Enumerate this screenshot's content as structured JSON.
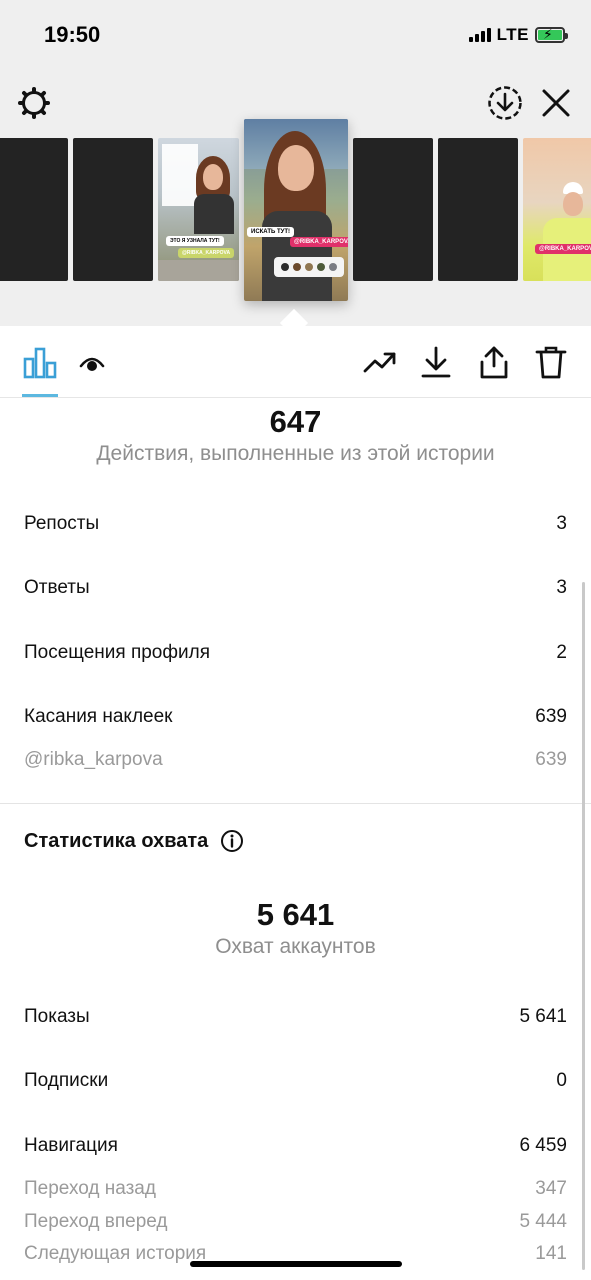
{
  "status_bar": {
    "time": "19:50",
    "network": "LTE",
    "battery_color": "#34c759"
  },
  "top_bar": {
    "left_icon": "settings-gear-icon",
    "right_icons": [
      "download-circle-icon",
      "close-icon"
    ]
  },
  "story_strip": {
    "active_story": {
      "caption": "ИСКАТЬ ТУТ!",
      "tag": "@RIBKA_KARPOVA"
    },
    "left_story": {
      "caption": "ЭТО Я УЗНАЛА ТУТ!",
      "tag": "@RIBKA_KARPOVA"
    },
    "right_story": {
      "tag": "@RIBKA_KARPOVA"
    }
  },
  "tabs": {
    "items": [
      "insights-bar-chart-icon",
      "viewers-eye-icon"
    ],
    "actions": [
      "promote-trend-icon",
      "download-icon",
      "share-icon",
      "delete-trash-icon"
    ],
    "accent_color": "#5cb8e0"
  },
  "interactions": {
    "total": "647",
    "caption": "Действия, выполненные из этой истории",
    "rows": [
      {
        "label": "Репосты",
        "value": "3"
      },
      {
        "label": "Ответы",
        "value": "3"
      },
      {
        "label": "Посещения профиля",
        "value": "2"
      },
      {
        "label": "Касания наклеек",
        "value": "639"
      }
    ],
    "sub_rows": [
      {
        "label": "@ribka_karpova",
        "value": "639"
      }
    ]
  },
  "reach": {
    "title": "Статистика охвата",
    "total": "5 641",
    "caption": "Охват аккаунтов",
    "rows": [
      {
        "label": "Показы",
        "value": "5 641"
      },
      {
        "label": "Подписки",
        "value": "0"
      },
      {
        "label": "Навигация",
        "value": "6 459"
      }
    ],
    "sub_rows": [
      {
        "label": "Переход назад",
        "value": "347"
      },
      {
        "label": "Переход вперед",
        "value": "5 444"
      },
      {
        "label": "Следующая история",
        "value": "141"
      }
    ]
  }
}
